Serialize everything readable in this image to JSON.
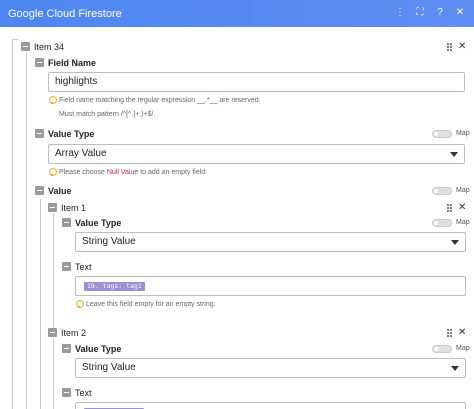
{
  "window": {
    "title": "Google Cloud Firestore",
    "controls": [
      "dots-menu-icon",
      "fullscreen-icon",
      "help-icon",
      "close-icon"
    ]
  },
  "item34": {
    "label": "Item 34",
    "field_name": {
      "label": "Field Name",
      "value": "highlights",
      "hint_prefix": "Field name matching the regular expression",
      "hint_code": "__.*__",
      "hint_suffix": "are reserved.",
      "hint_pattern": "Must match pattern /^[^.]+.)+$/."
    },
    "value_type": {
      "label": "Value Type",
      "map_label": "Map",
      "selected": "Array Value",
      "hint_prefix": "Please choose",
      "hint_null": "Null Value",
      "hint_suffix": "to add an empty field."
    },
    "value": {
      "label": "Value",
      "map_label": "Map",
      "item1": {
        "label": "Item 1",
        "value_type_label": "Value Type",
        "map_label": "Map",
        "selected": "String Value",
        "text_label": "Text",
        "text_pill": "19. tags: tag1",
        "text_hint": "Leave this field empty for an empty string."
      },
      "item2": {
        "label": "Item 2",
        "value_type_label": "Value Type",
        "map_label": "Map",
        "selected": "String Value",
        "text_label": "Text"
      }
    }
  },
  "colors": {
    "titlebar": "#5a8cf2",
    "pill": "#9b8fd6",
    "hint_bulb": "#f0b020"
  }
}
